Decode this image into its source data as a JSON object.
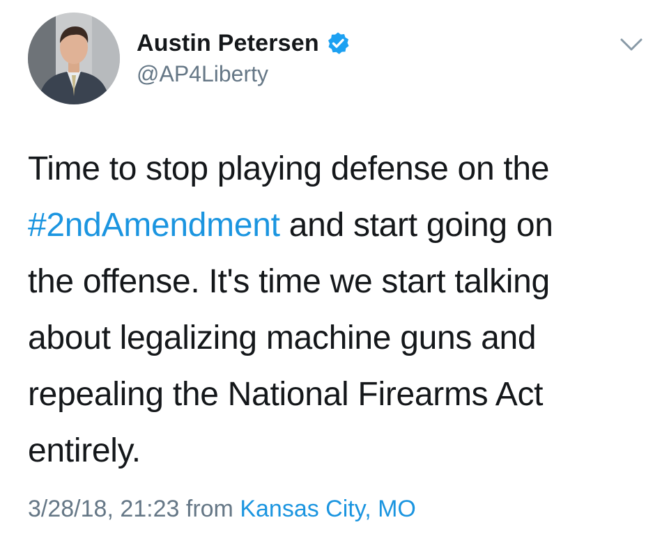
{
  "user": {
    "display_name": "Austin Petersen",
    "handle": "@AP4Liberty",
    "verified": true,
    "avatar_icon": "profile-photo"
  },
  "tweet": {
    "lines": [
      {
        "before": "Time to stop playing defense on the",
        "hashtag": "",
        "after": ""
      },
      {
        "before": "",
        "hashtag": "#2ndAmendment",
        "after": " and start going on"
      },
      {
        "before": "the offense. It's time we start talking",
        "hashtag": "",
        "after": ""
      },
      {
        "before": "about legalizing machine guns and",
        "hashtag": "",
        "after": ""
      },
      {
        "before": "repealing the National Firearms Act",
        "hashtag": "",
        "after": ""
      },
      {
        "before": "entirely.",
        "hashtag": "",
        "after": ""
      }
    ]
  },
  "meta": {
    "timestamp": "3/28/18, 21:23",
    "from_label": "from",
    "location": "Kansas City, MO"
  },
  "colors": {
    "link": "#1b95e0",
    "secondary_text": "#657786",
    "primary_text": "#14171a",
    "verified_badge": "#1da1f2"
  },
  "icons": {
    "more": "chevron-down-icon",
    "verified": "verified-badge-icon"
  }
}
